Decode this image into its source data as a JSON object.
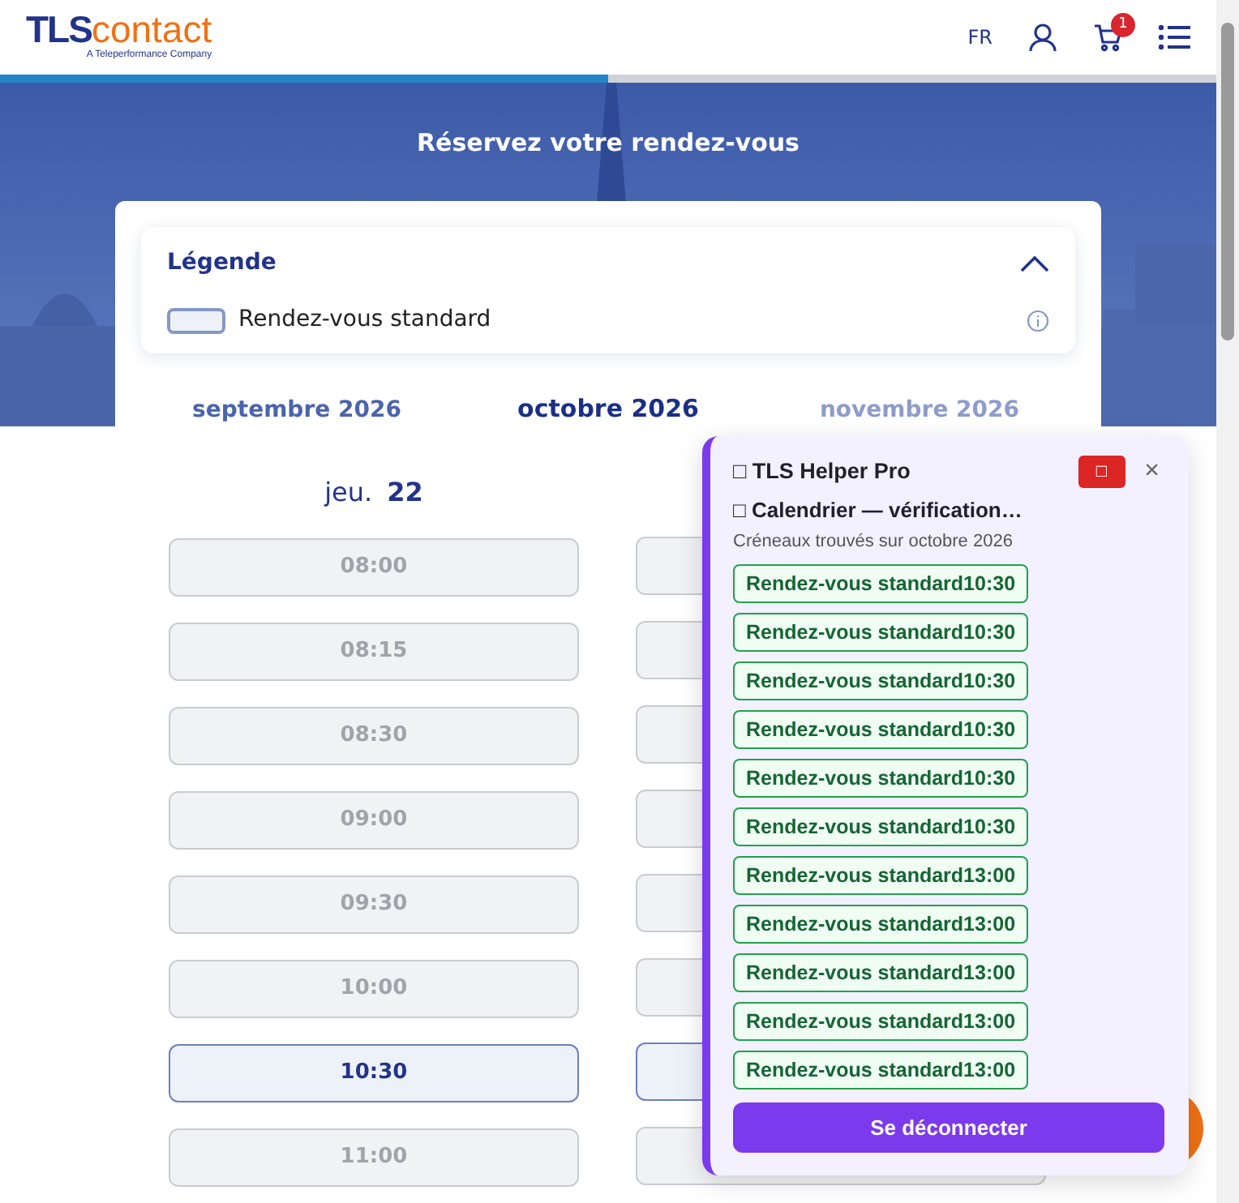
{
  "header": {
    "logo": {
      "brand_a": "TLS",
      "brand_b": "contact",
      "tagline": "A Teleperformance Company"
    },
    "language": "FR",
    "cart_count": "1",
    "progress": {
      "level": 0.5
    }
  },
  "hero": {
    "title": "Réservez votre rendez-vous"
  },
  "legend": {
    "title": "Légende",
    "expanded": true,
    "items": [
      {
        "label": "Rendez-vous standard"
      }
    ]
  },
  "months": [
    {
      "label": "septembre 2026",
      "selected": false,
      "disabled": false
    },
    {
      "label": "octobre 2026",
      "selected": true,
      "disabled": false
    },
    {
      "label": "novembre 2026",
      "selected": false,
      "disabled": true
    }
  ],
  "day": {
    "weekday": "jeu.",
    "date": "22"
  },
  "slots": [
    {
      "time": "08:00",
      "selected": false
    },
    {
      "time": "08:15",
      "selected": false
    },
    {
      "time": "08:30",
      "selected": false
    },
    {
      "time": "09:00",
      "selected": false
    },
    {
      "time": "09:30",
      "selected": false
    },
    {
      "time": "10:00",
      "selected": false
    },
    {
      "time": "10:30",
      "selected": true
    },
    {
      "time": "11:00",
      "selected": false
    }
  ],
  "hidden_column_slots": [
    {
      "selected": false
    },
    {
      "selected": false
    },
    {
      "selected": false
    },
    {
      "selected": false
    },
    {
      "selected": false
    },
    {
      "selected": false
    },
    {
      "selected": true
    },
    {
      "selected": false
    }
  ],
  "helper": {
    "title": "□ TLS Helper Pro",
    "stop_glyph": "□",
    "close": "×",
    "status": "□ Calendrier — vérification…",
    "subtitle": "Créneaux trouvés sur octobre 2026",
    "results": [
      "Rendez-vous standard10:30",
      "Rendez-vous standard10:30",
      "Rendez-vous standard10:30",
      "Rendez-vous standard10:30",
      "Rendez-vous standard10:30",
      "Rendez-vous standard10:30",
      "Rendez-vous standard13:00",
      "Rendez-vous standard13:00",
      "Rendez-vous standard13:00",
      "Rendez-vous standard13:00",
      "Rendez-vous standard13:00"
    ],
    "logout": "Se déconnecter"
  }
}
